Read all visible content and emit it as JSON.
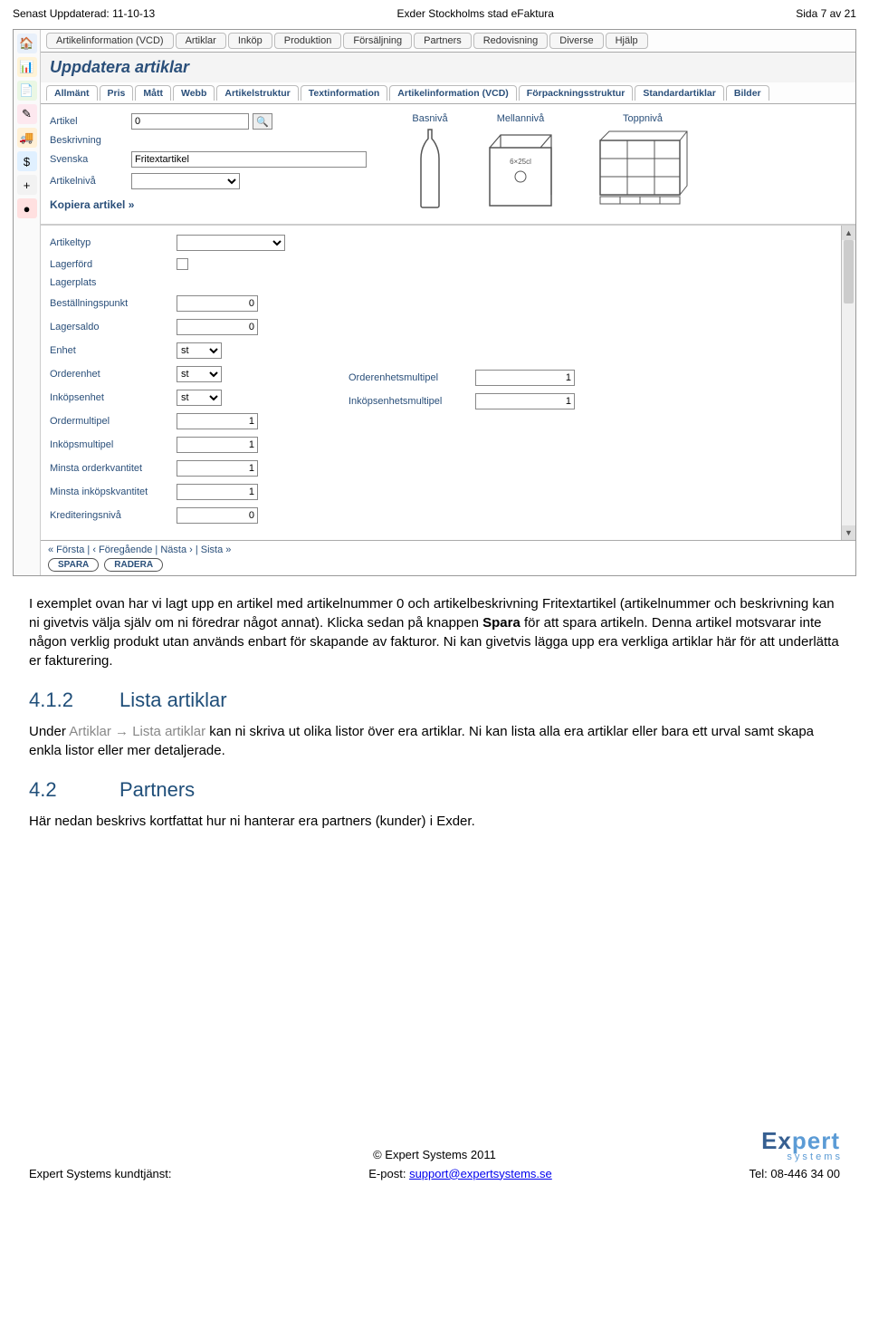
{
  "header": {
    "left": "Senast Uppdaterad: 11-10-13",
    "center": "Exder Stockholms stad eFaktura",
    "right": "Sida 7 av 21"
  },
  "menubar": [
    "Artikelinformation (VCD)",
    "Artiklar",
    "Inköp",
    "Produktion",
    "Försäljning",
    "Partners",
    "Redovisning",
    "Diverse",
    "Hjälp"
  ],
  "sidebar_icons": [
    {
      "glyph": "🏠",
      "bg": "#e8f0fa"
    },
    {
      "glyph": "📊",
      "bg": "#fff3d6"
    },
    {
      "glyph": "📄",
      "bg": "#eaf7e4"
    },
    {
      "glyph": "✎",
      "bg": "#fde8ef"
    },
    {
      "glyph": "🚚",
      "bg": "#fff0d6"
    },
    {
      "glyph": "$",
      "bg": "#e0f0ff"
    },
    {
      "glyph": "+",
      "bg": "#f2f2f2"
    },
    {
      "glyph": "●",
      "bg": "#ffe0e0"
    }
  ],
  "page_title": "Uppdatera artiklar",
  "subtabs": [
    "Allmänt",
    "Pris",
    "Mått",
    "Webb",
    "Artikelstruktur",
    "Textinformation",
    "Artikelinformation (VCD)",
    "Förpackningsstruktur",
    "Standardartiklar",
    "Bilder"
  ],
  "form": {
    "artikel_label": "Artikel",
    "artikel_value": "0",
    "beskrivning_label": "Beskrivning",
    "svenska_label": "Svenska",
    "svenska_value": "Fritextartikel",
    "artikelniva_label": "Artikelnivå",
    "kopiera_label": "Kopiera artikel »"
  },
  "nivas": {
    "bas": "Basnivå",
    "mellan": "Mellannivå",
    "topp": "Toppnivå"
  },
  "rows": {
    "artikeltyp": "Artikeltyp",
    "lagerford": "Lagerförd",
    "lagerplats": "Lagerplats",
    "bestallningspunkt": "Beställningspunkt",
    "bestallningspunkt_val": "0",
    "lagersaldo": "Lagersaldo",
    "lagersaldo_val": "0",
    "enhet": "Enhet",
    "enhet_val": "st",
    "orderenhet": "Orderenhet",
    "orderenhet_val": "st",
    "orderenhetsmultipel": "Orderenhetsmultipel",
    "orderenhetsmultipel_val": "1",
    "inkopsenhet": "Inköpsenhet",
    "inkopsenhet_val": "st",
    "inkopsenhetsmultipel": "Inköpsenhetsmultipel",
    "inkopsenhetsmultipel_val": "1",
    "ordermultipel": "Ordermultipel",
    "ordermultipel_val": "1",
    "inkopsmultipel": "Inköpsmultipel",
    "inkopsmultipel_val": "1",
    "minsta_orderkvantitet": "Minsta orderkvantitet",
    "minsta_orderkvantitet_val": "1",
    "minsta_inkopskvantitet": "Minsta inköpskvantitet",
    "minsta_inkopskvantitet_val": "1",
    "krediteringsniva": "Krediteringsnivå",
    "krediteringsniva_val": "0"
  },
  "pager": {
    "text": "« Första  |  ‹ Föregående  |  Nästa ›  |  Sista »",
    "spara": "SPARA",
    "radera": "RADERA"
  },
  "body": {
    "p1": "I exemplet ovan har vi lagt upp en artikel med artikelnummer 0 och artikelbeskrivning Fritextartikel (artikelnummer och beskrivning kan ni givetvis välja själv om ni föredrar något annat). Klicka sedan på knappen ",
    "p1b": "Spara",
    "p1c": " för att spara artikeln. Denna artikel motsvarar inte någon verklig produkt utan används enbart för skapande av fakturor. Ni kan givetvis lägga upp era verkliga artiklar här för att underlätta er fakturering.",
    "h412_num": "4.1.2",
    "h412": "Lista artiklar",
    "p2a": "Under ",
    "p2g1": "Artiklar",
    "p2arrow": " → ",
    "p2g2": "Lista artiklar",
    "p2b": " kan ni skriva ut olika listor över era artiklar. Ni kan lista alla era artiklar eller bara ett urval samt skapa enkla listor eller mer detaljerade.",
    "h42_num": "4.2",
    "h42": "Partners",
    "p3": "Här nedan beskrivs kortfattat hur ni hanterar era partners (kunder) i Exder."
  },
  "footer": {
    "copy": "© Expert Systems 2011",
    "left": "Expert Systems kundtjänst:",
    "mid_label": "E-post: ",
    "mid_link": "support@expertsystems.se",
    "right": "Tel: 08-446 34 00",
    "logo_ex": "Ex",
    "logo_pert": "pert",
    "logo_sub": "s  y  s  t  e  m  s"
  }
}
